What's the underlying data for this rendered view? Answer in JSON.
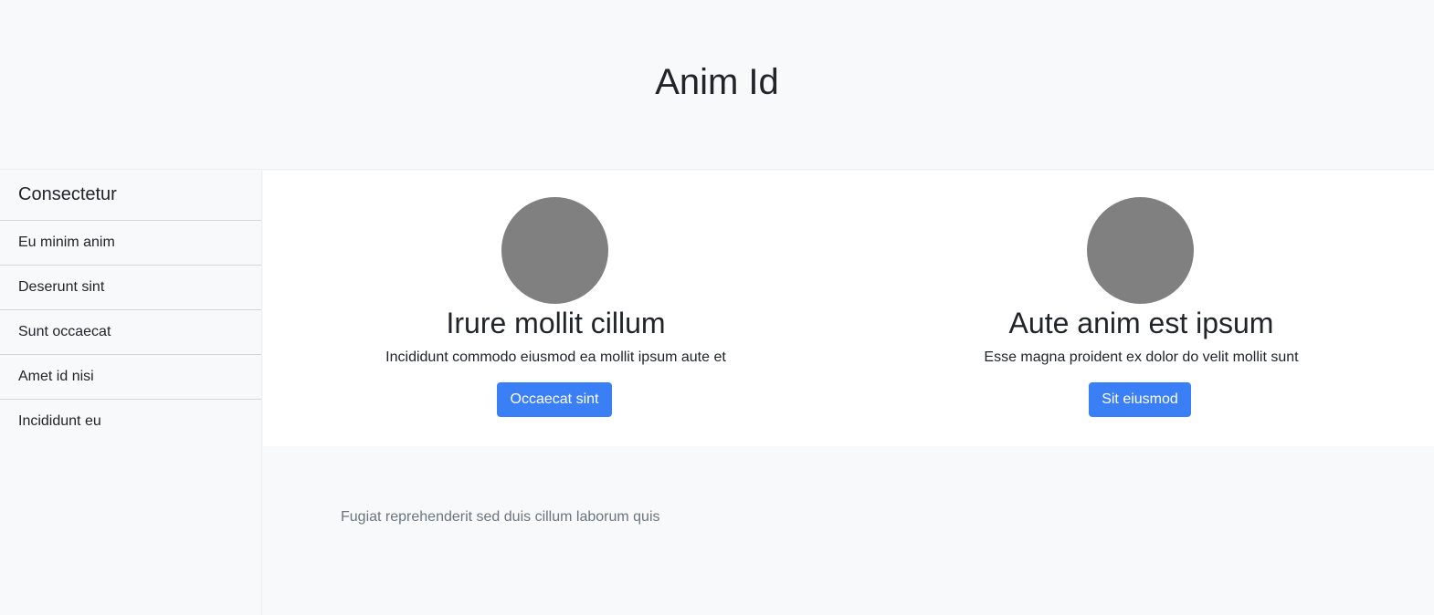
{
  "header": {
    "title": "Anim Id"
  },
  "sidebar": {
    "heading": "Consectetur",
    "items": [
      {
        "label": "Eu minim anim"
      },
      {
        "label": "Deserunt sint"
      },
      {
        "label": "Sunt occaecat"
      },
      {
        "label": "Amet id nisi"
      },
      {
        "label": "Incididunt eu"
      }
    ]
  },
  "features": [
    {
      "avatar_color": "#808080",
      "title": "Irure mollit cillum",
      "text": "Incididunt commodo eiusmod ea mollit ipsum aute et",
      "button_label": "Occaecat sint"
    },
    {
      "avatar_color": "#808080",
      "title": "Aute anim est ipsum",
      "text": "Esse magna proident ex dolor do velit mollit sunt",
      "button_label": "Sit eiusmod"
    }
  ],
  "footer": {
    "text": "Fugiat reprehenderit sed duis cillum laborum quis"
  },
  "colors": {
    "accent": "#3a7ff6",
    "background": "#f8f9fa",
    "muted_text": "#6c757d"
  }
}
